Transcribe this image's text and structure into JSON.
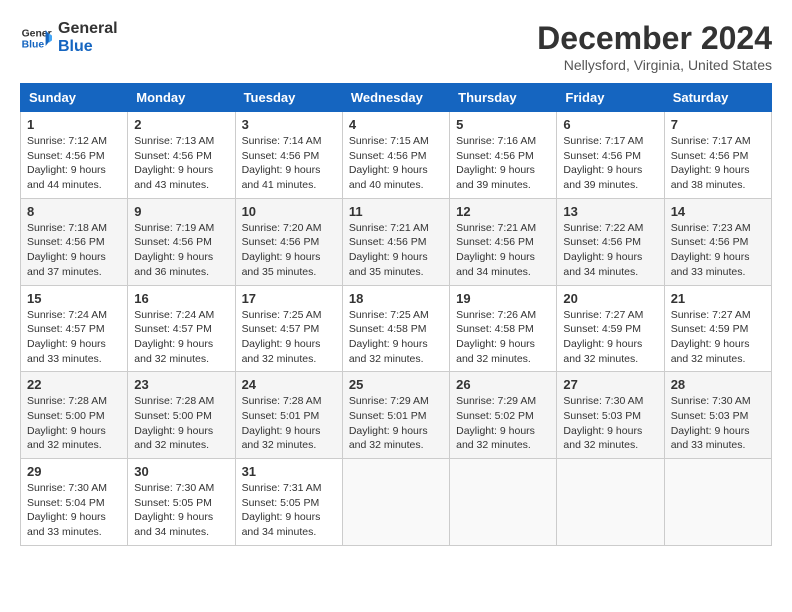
{
  "header": {
    "logo_line1": "General",
    "logo_line2": "Blue",
    "title": "December 2024",
    "subtitle": "Nellysford, Virginia, United States"
  },
  "calendar": {
    "days_of_week": [
      "Sunday",
      "Monday",
      "Tuesday",
      "Wednesday",
      "Thursday",
      "Friday",
      "Saturday"
    ],
    "weeks": [
      [
        {
          "num": "1",
          "sunrise": "7:12 AM",
          "sunset": "4:56 PM",
          "daylight": "9 hours and 44 minutes."
        },
        {
          "num": "2",
          "sunrise": "7:13 AM",
          "sunset": "4:56 PM",
          "daylight": "9 hours and 43 minutes."
        },
        {
          "num": "3",
          "sunrise": "7:14 AM",
          "sunset": "4:56 PM",
          "daylight": "9 hours and 41 minutes."
        },
        {
          "num": "4",
          "sunrise": "7:15 AM",
          "sunset": "4:56 PM",
          "daylight": "9 hours and 40 minutes."
        },
        {
          "num": "5",
          "sunrise": "7:16 AM",
          "sunset": "4:56 PM",
          "daylight": "9 hours and 39 minutes."
        },
        {
          "num": "6",
          "sunrise": "7:17 AM",
          "sunset": "4:56 PM",
          "daylight": "9 hours and 39 minutes."
        },
        {
          "num": "7",
          "sunrise": "7:17 AM",
          "sunset": "4:56 PM",
          "daylight": "9 hours and 38 minutes."
        }
      ],
      [
        {
          "num": "8",
          "sunrise": "7:18 AM",
          "sunset": "4:56 PM",
          "daylight": "9 hours and 37 minutes."
        },
        {
          "num": "9",
          "sunrise": "7:19 AM",
          "sunset": "4:56 PM",
          "daylight": "9 hours and 36 minutes."
        },
        {
          "num": "10",
          "sunrise": "7:20 AM",
          "sunset": "4:56 PM",
          "daylight": "9 hours and 35 minutes."
        },
        {
          "num": "11",
          "sunrise": "7:21 AM",
          "sunset": "4:56 PM",
          "daylight": "9 hours and 35 minutes."
        },
        {
          "num": "12",
          "sunrise": "7:21 AM",
          "sunset": "4:56 PM",
          "daylight": "9 hours and 34 minutes."
        },
        {
          "num": "13",
          "sunrise": "7:22 AM",
          "sunset": "4:56 PM",
          "daylight": "9 hours and 34 minutes."
        },
        {
          "num": "14",
          "sunrise": "7:23 AM",
          "sunset": "4:56 PM",
          "daylight": "9 hours and 33 minutes."
        }
      ],
      [
        {
          "num": "15",
          "sunrise": "7:24 AM",
          "sunset": "4:57 PM",
          "daylight": "9 hours and 33 minutes."
        },
        {
          "num": "16",
          "sunrise": "7:24 AM",
          "sunset": "4:57 PM",
          "daylight": "9 hours and 32 minutes."
        },
        {
          "num": "17",
          "sunrise": "7:25 AM",
          "sunset": "4:57 PM",
          "daylight": "9 hours and 32 minutes."
        },
        {
          "num": "18",
          "sunrise": "7:25 AM",
          "sunset": "4:58 PM",
          "daylight": "9 hours and 32 minutes."
        },
        {
          "num": "19",
          "sunrise": "7:26 AM",
          "sunset": "4:58 PM",
          "daylight": "9 hours and 32 minutes."
        },
        {
          "num": "20",
          "sunrise": "7:27 AM",
          "sunset": "4:59 PM",
          "daylight": "9 hours and 32 minutes."
        },
        {
          "num": "21",
          "sunrise": "7:27 AM",
          "sunset": "4:59 PM",
          "daylight": "9 hours and 32 minutes."
        }
      ],
      [
        {
          "num": "22",
          "sunrise": "7:28 AM",
          "sunset": "5:00 PM",
          "daylight": "9 hours and 32 minutes."
        },
        {
          "num": "23",
          "sunrise": "7:28 AM",
          "sunset": "5:00 PM",
          "daylight": "9 hours and 32 minutes."
        },
        {
          "num": "24",
          "sunrise": "7:28 AM",
          "sunset": "5:01 PM",
          "daylight": "9 hours and 32 minutes."
        },
        {
          "num": "25",
          "sunrise": "7:29 AM",
          "sunset": "5:01 PM",
          "daylight": "9 hours and 32 minutes."
        },
        {
          "num": "26",
          "sunrise": "7:29 AM",
          "sunset": "5:02 PM",
          "daylight": "9 hours and 32 minutes."
        },
        {
          "num": "27",
          "sunrise": "7:30 AM",
          "sunset": "5:03 PM",
          "daylight": "9 hours and 32 minutes."
        },
        {
          "num": "28",
          "sunrise": "7:30 AM",
          "sunset": "5:03 PM",
          "daylight": "9 hours and 33 minutes."
        }
      ],
      [
        {
          "num": "29",
          "sunrise": "7:30 AM",
          "sunset": "5:04 PM",
          "daylight": "9 hours and 33 minutes."
        },
        {
          "num": "30",
          "sunrise": "7:30 AM",
          "sunset": "5:05 PM",
          "daylight": "9 hours and 34 minutes."
        },
        {
          "num": "31",
          "sunrise": "7:31 AM",
          "sunset": "5:05 PM",
          "daylight": "9 hours and 34 minutes."
        },
        null,
        null,
        null,
        null
      ]
    ]
  }
}
